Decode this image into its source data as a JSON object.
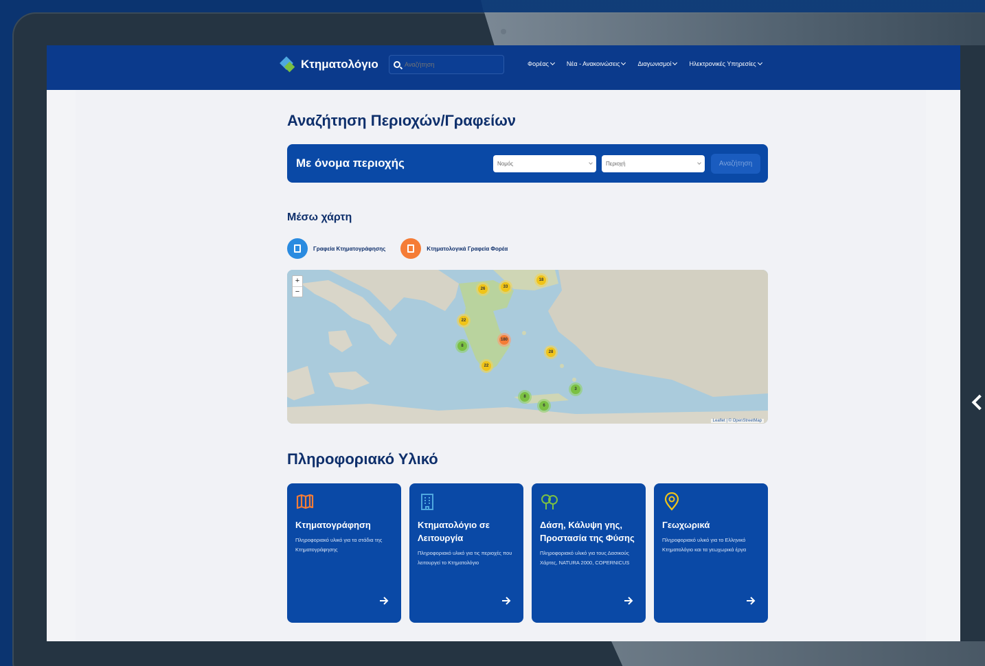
{
  "nav": {
    "brand": "Κτηματολόγιο",
    "search_placeholder": "Αναζήτηση",
    "menu": [
      {
        "label": "Φορέας"
      },
      {
        "label": "Νέα - Ανακοινώσεις"
      },
      {
        "label": "Διαγωνισμοί"
      },
      {
        "label": "Ηλεκτρονικές Υπηρεσίες"
      }
    ]
  },
  "page": {
    "title": "Αναζήτηση Περιοχών/Γραφείων",
    "search": {
      "label": "Με όνομα περιοχής",
      "prefecture_placeholder": "Νομός",
      "area_placeholder": "Περιοχή",
      "button": "Αναζήτηση"
    },
    "map_section": {
      "title": "Μέσω χάρτη",
      "legend": [
        {
          "label": "Γραφεία Κτηματογράφησης",
          "color": "#2a8be0"
        },
        {
          "label": "Κτηματολογικά Γραφεία Φορέα",
          "color": "#f57c36"
        }
      ],
      "zoom_in": "+",
      "zoom_out": "−",
      "attribution": "Leaflet | © OpenStreetMap",
      "clusters": [
        {
          "count": "26"
        },
        {
          "count": "33"
        },
        {
          "count": "18"
        },
        {
          "count": "22"
        },
        {
          "count": "180"
        },
        {
          "count": "8"
        },
        {
          "count": "22"
        },
        {
          "count": "28"
        },
        {
          "count": "8"
        },
        {
          "count": "6"
        },
        {
          "count": "3"
        }
      ]
    },
    "info_title": "Πληροφοριακό Υλικό",
    "cards": [
      {
        "icon": "map-icon",
        "title": "Κτηματογράφηση",
        "desc": "Πληροφοριακό υλικό για τα στάδια της Κτηματογράφησης"
      },
      {
        "icon": "building-icon",
        "title": "Κτηματολόγιο σε Λειτουργία",
        "desc": "Πληροφοριακό υλικό για τις περιοχές που λειτουργεί το Κτηματολόγιο"
      },
      {
        "icon": "trees-icon",
        "title": "Δάση, Κάλυψη γης, Προστασία της Φύσης",
        "desc": "Πληροφοριακό υλικό για τους Δασικούς Χάρτες, NATURA 2000, COPERNICUS"
      },
      {
        "icon": "location-pin-icon",
        "title": "Γεωχωρικά",
        "desc": "Πληροφοριακό υλικό για το Ελληνικό Κτηματολόγιο και τα γεωχωρικά έργα"
      }
    ]
  }
}
